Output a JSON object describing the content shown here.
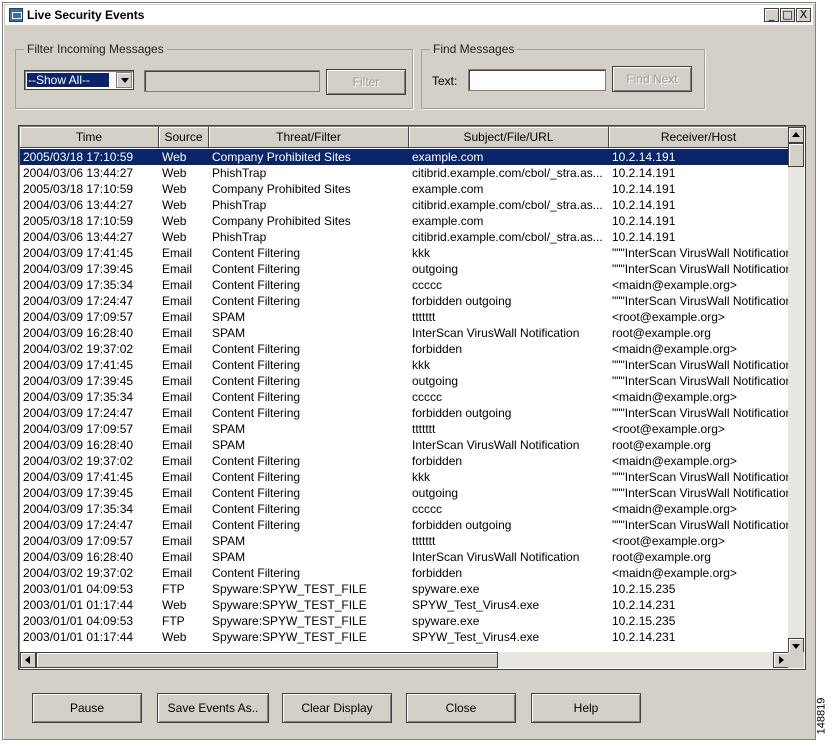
{
  "window": {
    "title": "Live Security Events"
  },
  "title_controls": [
    "_",
    "□",
    "X"
  ],
  "filter": {
    "group_label": "Filter Incoming Messages",
    "dropdown_value": "--Show All--",
    "filter_button": "Filter"
  },
  "find": {
    "group_label": "Find Messages",
    "text_label": "Text:",
    "find_next_button": "Find Next"
  },
  "table": {
    "columns": [
      "Time",
      "Source",
      "Threat/Filter",
      "Subject/File/URL",
      "Receiver/Host"
    ],
    "rows": [
      [
        "2005/03/18 17:10:59",
        "Web",
        "Company Prohibited Sites",
        "example.com",
        "10.2.14.191"
      ],
      [
        "2004/03/06 13:44:27",
        "Web",
        "PhishTrap",
        "citibrid.example.com/cbol/_stra.as...",
        "10.2.14.191"
      ],
      [
        "2005/03/18 17:10:59",
        "Web",
        "Company Prohibited Sites",
        "example.com",
        "10.2.14.191"
      ],
      [
        "2004/03/06 13:44:27",
        "Web",
        "PhishTrap",
        "citibrid.example.com/cbol/_stra.as...",
        "10.2.14.191"
      ],
      [
        "2005/03/18 17:10:59",
        "Web",
        "Company Prohibited Sites",
        "example.com",
        "10.2.14.191"
      ],
      [
        "2004/03/06 13:44:27",
        "Web",
        "PhishTrap",
        "citibrid.example.com/cbol/_stra.as...",
        "10.2.14.191"
      ],
      [
        "2004/03/09 17:41:45",
        "Email",
        "Content Filtering",
        "kkk",
        "\"\"\"InterScan VirusWall Notification"
      ],
      [
        "2004/03/09 17:39:45",
        "Email",
        "Content Filtering",
        "outgoing",
        "\"\"\"InterScan VirusWall Notification"
      ],
      [
        "2004/03/09 17:35:34",
        "Email",
        "Content Filtering",
        "ccccc",
        "<maidn@example.org>"
      ],
      [
        "2004/03/09 17:24:47",
        "Email",
        "Content Filtering",
        "forbidden outgoing",
        "\"\"\"InterScan VirusWall Notification"
      ],
      [
        "2004/03/09 17:09:57",
        "Email",
        "SPAM",
        "ttttttt",
        "<root@example.org>"
      ],
      [
        "2004/03/09 16:28:40",
        "Email",
        "SPAM",
        "InterScan VirusWall Notification",
        "root@example.org"
      ],
      [
        "2004/03/02 19:37:02",
        "Email",
        "Content Filtering",
        "forbidden",
        "<maidn@example.org>"
      ],
      [
        "2004/03/09 17:41:45",
        "Email",
        "Content Filtering",
        "kkk",
        "\"\"\"InterScan VirusWall Notification"
      ],
      [
        "2004/03/09 17:39:45",
        "Email",
        "Content Filtering",
        "outgoing",
        "\"\"\"InterScan VirusWall Notification"
      ],
      [
        "2004/03/09 17:35:34",
        "Email",
        "Content Filtering",
        "ccccc",
        "<maidn@example.org>"
      ],
      [
        "2004/03/09 17:24:47",
        "Email",
        "Content Filtering",
        "forbidden outgoing",
        "\"\"\"InterScan VirusWall Notification"
      ],
      [
        "2004/03/09 17:09:57",
        "Email",
        "SPAM",
        "ttttttt",
        "<root@example.org>"
      ],
      [
        "2004/03/09 16:28:40",
        "Email",
        "SPAM",
        "InterScan VirusWall Notification",
        "root@example.org"
      ],
      [
        "2004/03/02 19:37:02",
        "Email",
        "Content Filtering",
        "forbidden",
        "<maidn@example.org>"
      ],
      [
        "2004/03/09 17:41:45",
        "Email",
        "Content Filtering",
        "kkk",
        "\"\"\"InterScan VirusWall Notification"
      ],
      [
        "2004/03/09 17:39:45",
        "Email",
        "Content Filtering",
        "outgoing",
        "\"\"\"InterScan VirusWall Notification"
      ],
      [
        "2004/03/09 17:35:34",
        "Email",
        "Content Filtering",
        "ccccc",
        "<maidn@example.org>"
      ],
      [
        "2004/03/09 17:24:47",
        "Email",
        "Content Filtering",
        "forbidden outgoing",
        "\"\"\"InterScan VirusWall Notification"
      ],
      [
        "2004/03/09 17:09:57",
        "Email",
        "SPAM",
        "ttttttt",
        "<root@example.org>"
      ],
      [
        "2004/03/09 16:28:40",
        "Email",
        "SPAM",
        "InterScan VirusWall Notification",
        "root@example.org"
      ],
      [
        "2004/03/02 19:37:02",
        "Email",
        "Content Filtering",
        "forbidden",
        "<maidn@example.org>"
      ],
      [
        "2003/01/01 04:09:53",
        "FTP",
        "Spyware:SPYW_TEST_FILE",
        "spyware.exe",
        "10.2.15.235"
      ],
      [
        "2003/01/01 01:17:44",
        "Web",
        "Spyware:SPYW_TEST_FILE",
        "SPYW_Test_Virus4.exe",
        "10.2.14.231"
      ],
      [
        "2003/01/01 04:09:53",
        "FTP",
        "Spyware:SPYW_TEST_FILE",
        "spyware.exe",
        "10.2.15.235"
      ],
      [
        "2003/01/01 01:17:44",
        "Web",
        "Spyware:SPYW_TEST_FILE",
        "SPYW_Test_Virus4.exe",
        "10.2.14.231"
      ]
    ],
    "selected_row": 0
  },
  "buttons": {
    "pause": "Pause",
    "save": "Save Events As..",
    "clear": "Clear Display",
    "close": "Close",
    "help": "Help"
  },
  "figure_code": "148819",
  "colors": {
    "selection": "#0a246a",
    "face": "#d4d0c8"
  }
}
